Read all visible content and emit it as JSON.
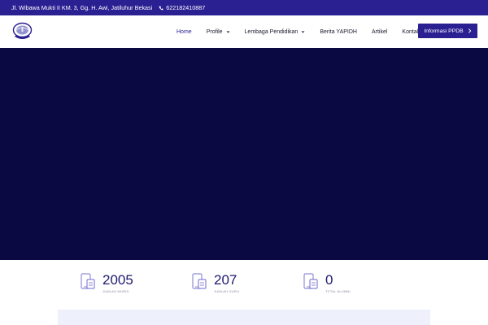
{
  "topbar": {
    "address": "Jl. Wibawa Mukti II KM. 3, Gg. H. Awi, Jatiluhur Bekasi",
    "phone": "622182410887",
    "icons": {
      "phone": "phone-icon"
    }
  },
  "nav": {
    "items": [
      {
        "label": "Home",
        "active": true,
        "has_dropdown": false
      },
      {
        "label": "Profile",
        "active": false,
        "has_dropdown": true
      },
      {
        "label": "Lembaga Pendidikan",
        "active": false,
        "has_dropdown": true
      },
      {
        "label": "Berita YAPIDH",
        "active": false,
        "has_dropdown": false
      },
      {
        "label": "Artikel",
        "active": false,
        "has_dropdown": false
      },
      {
        "label": "Kontak",
        "active": false,
        "has_dropdown": false
      }
    ],
    "cta_label": "Informasi PPDB",
    "icons": {
      "dropdown": "chevron-down-icon",
      "cta": "chevron-right-icon",
      "logo": "school-logo"
    }
  },
  "stats": [
    {
      "value": "2005",
      "label": "Jumlah Murid",
      "icon": "tablet-icon"
    },
    {
      "value": "207",
      "label": "Jumlah Guru",
      "icon": "tablet-icon"
    },
    {
      "value": "0",
      "label": "Total Alumni",
      "icon": "tablet-icon"
    }
  ],
  "colors": {
    "brand": "#2b2092",
    "hero": "#0b0942",
    "stat_number": "#1e1a6e",
    "panel": "#eef1fb"
  }
}
